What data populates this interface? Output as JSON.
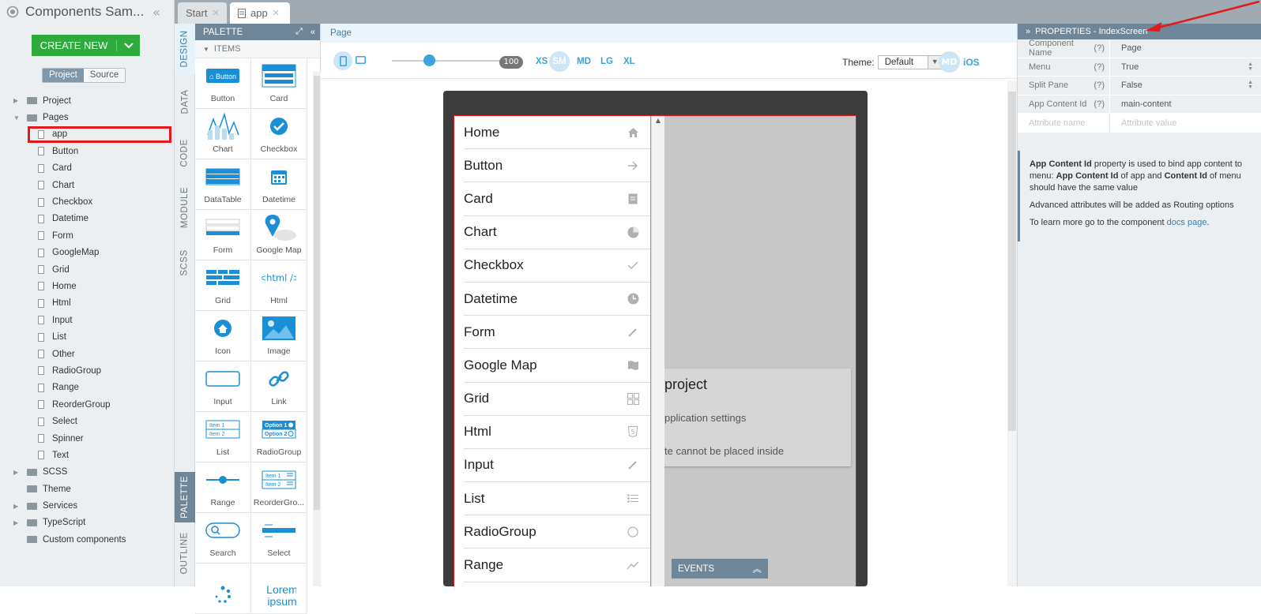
{
  "app": {
    "title": "Components Sam..."
  },
  "create_new": {
    "label": "CREATE NEW"
  },
  "view_switch": {
    "project": "Project",
    "source": "Source"
  },
  "tree": [
    {
      "label": "Project",
      "kind": "folder",
      "arrow": "▶"
    },
    {
      "label": "Pages",
      "kind": "folder",
      "arrow": "▼"
    },
    {
      "label": "app",
      "kind": "file",
      "selected": true
    },
    {
      "label": "Button",
      "kind": "file"
    },
    {
      "label": "Card",
      "kind": "file"
    },
    {
      "label": "Chart",
      "kind": "file"
    },
    {
      "label": "Checkbox",
      "kind": "file"
    },
    {
      "label": "Datetime",
      "kind": "file"
    },
    {
      "label": "Form",
      "kind": "file"
    },
    {
      "label": "GoogleMap",
      "kind": "file"
    },
    {
      "label": "Grid",
      "kind": "file"
    },
    {
      "label": "Home",
      "kind": "file"
    },
    {
      "label": "Html",
      "kind": "file"
    },
    {
      "label": "Input",
      "kind": "file"
    },
    {
      "label": "List",
      "kind": "file"
    },
    {
      "label": "Other",
      "kind": "file"
    },
    {
      "label": "RadioGroup",
      "kind": "file"
    },
    {
      "label": "Range",
      "kind": "file"
    },
    {
      "label": "ReorderGroup",
      "kind": "file"
    },
    {
      "label": "Select",
      "kind": "file"
    },
    {
      "label": "Spinner",
      "kind": "file"
    },
    {
      "label": "Text",
      "kind": "file"
    },
    {
      "label": "SCSS",
      "kind": "folder",
      "arrow": "▶"
    },
    {
      "label": "Theme",
      "kind": "folder"
    },
    {
      "label": "Services",
      "kind": "folder",
      "arrow": "▶"
    },
    {
      "label": "TypeScript",
      "kind": "folder",
      "arrow": "▶"
    },
    {
      "label": "Custom components",
      "kind": "folder"
    }
  ],
  "tabs": [
    {
      "label": "Start",
      "active": false
    },
    {
      "label": "app",
      "active": true
    }
  ],
  "vtabs": {
    "design": "DESIGN",
    "data": "DATA",
    "code": "CODE",
    "module": "MODULE",
    "scss": "SCSS",
    "palette": "PALETTE",
    "outline": "OUTLINE"
  },
  "palette": {
    "title": "PALETTE",
    "section": "ITEMS",
    "items": [
      "Button",
      "Card",
      "Chart",
      "Checkbox",
      "DataTable",
      "Datetime",
      "Form",
      "Google Map",
      "Grid",
      "Html",
      "Icon",
      "Image",
      "Input",
      "Link",
      "List",
      "RadioGroup",
      "Range",
      "ReorderGro...",
      "Search",
      "Select",
      "",
      ""
    ],
    "html_glyph": "<html />",
    "lorem": "Lorem ipsum",
    "list_item1": "Item 1",
    "list_item2": "Item 2",
    "radio_opt1": "Option 1",
    "radio_opt2": "Option 2"
  },
  "breadcrumb": "Page",
  "toolbar": {
    "zoom": "100",
    "breakpoints": [
      "XS",
      "SM",
      "MD",
      "LG",
      "XL"
    ],
    "theme_label": "Theme:",
    "theme_value": "Default",
    "platform_md": "MD",
    "platform_ios": "iOS"
  },
  "menu_items": [
    {
      "label": "Home",
      "icon": "home-icon"
    },
    {
      "label": "Button",
      "icon": "arrow-right-icon"
    },
    {
      "label": "Card",
      "icon": "document-icon"
    },
    {
      "label": "Chart",
      "icon": "pie-chart-icon"
    },
    {
      "label": "Checkbox",
      "icon": "checkmark-icon"
    },
    {
      "label": "Datetime",
      "icon": "clock-icon"
    },
    {
      "label": "Form",
      "icon": "pencil-icon"
    },
    {
      "label": "Google Map",
      "icon": "map-icon"
    },
    {
      "label": "Grid",
      "icon": "grid-icon"
    },
    {
      "label": "Html",
      "icon": "html5-icon"
    },
    {
      "label": "Input",
      "icon": "pencil-icon"
    },
    {
      "label": "List",
      "icon": "list-icon"
    },
    {
      "label": "RadioGroup",
      "icon": "radio-circle-icon"
    },
    {
      "label": "Range",
      "icon": "trending-icon"
    }
  ],
  "card": {
    "title": "project",
    "line1": "pplication settings",
    "line2": "te cannot be placed inside"
  },
  "events": "EVENTS",
  "properties": {
    "title": "PROPERTIES - IndexScreen",
    "rows": [
      {
        "key": "Component Name",
        "help": "(?)",
        "value": "Page"
      },
      {
        "key": "Menu",
        "help": "(?)",
        "value": "True"
      },
      {
        "key": "Split Pane",
        "help": "(?)",
        "value": "False"
      },
      {
        "key": "App Content Id",
        "help": "(?)",
        "value": "main-content"
      }
    ],
    "attr_name_placeholder": "Attribute name",
    "attr_value_placeholder": "Attribute value",
    "info_b1": "App Content Id",
    "info_t1": " property is used to bind app content to menu: ",
    "info_b2": "App Content Id",
    "info_t2": " of app and ",
    "info_b3": "Content Id",
    "info_t3": " of menu should have the same value",
    "info_p2": "Advanced attributes will be added as Routing options",
    "info_p3": "To learn more go to the component ",
    "info_link": "docs page",
    "info_p3_end": "."
  },
  "colors": {
    "accent": "#3ba3dd",
    "panel_header": "#6f8698",
    "create_green": "#2eab3c",
    "highlight_red": "#e21a1a"
  }
}
